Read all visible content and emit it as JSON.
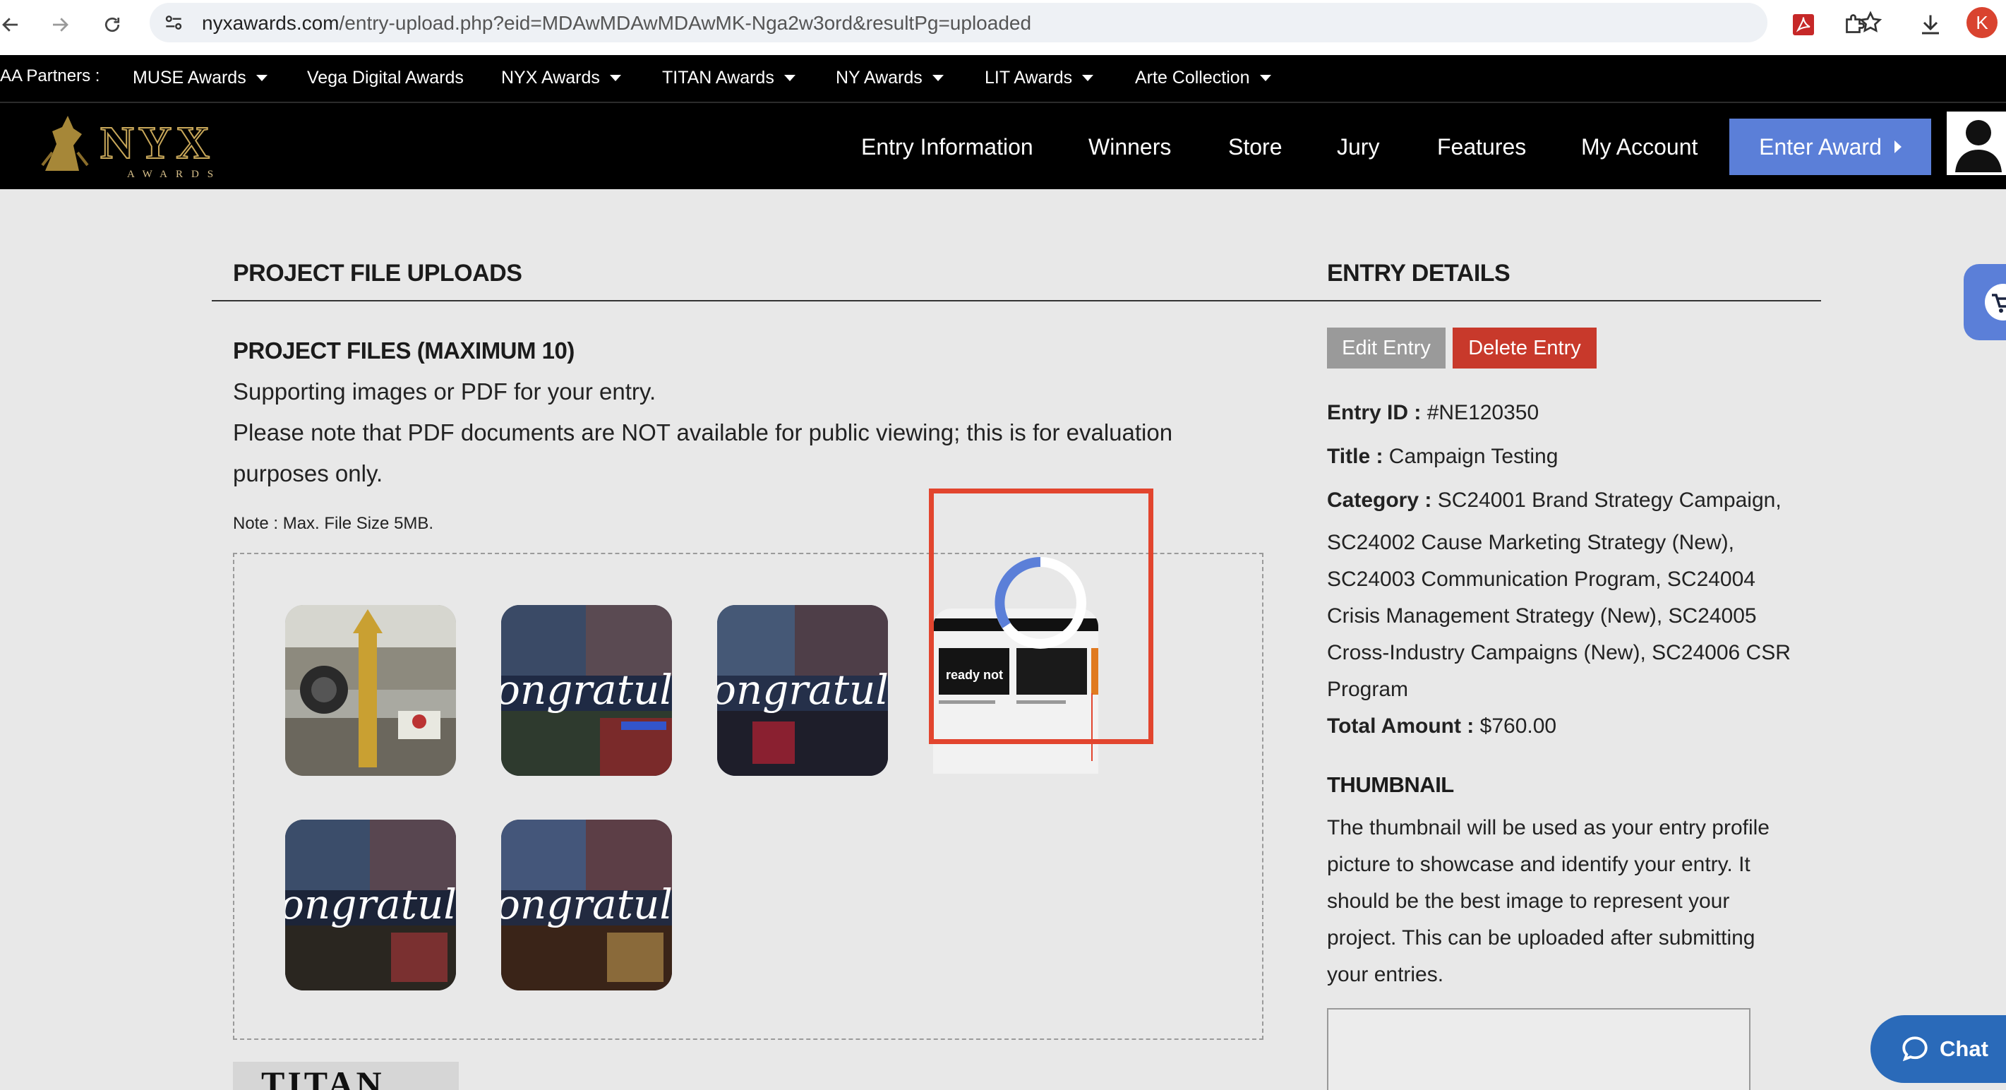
{
  "browser": {
    "url_host": "nyxawards.com",
    "url_path": "/entry-upload.php?eid=MDAwMDAwMDAwMK-Nga2w3ord&resultPg=uploaded",
    "profile_initial": "K"
  },
  "partners": {
    "label": "AA Partners :",
    "items": [
      "MUSE Awards",
      "Vega Digital Awards",
      "NYX Awards",
      "TITAN Awards",
      "NY Awards",
      "LIT Awards",
      "Arte Collection"
    ]
  },
  "header": {
    "logo_text": "NYX",
    "logo_sub": "AWARDS",
    "nav": [
      "Entry Information",
      "Winners",
      "Store",
      "Jury",
      "Features",
      "My Account"
    ],
    "enter_button": "Enter Award"
  },
  "uploads": {
    "section_title": "PROJECT FILE UPLOADS",
    "files_title": "PROJECT FILES (MAXIMUM 10)",
    "line1": "Supporting images or PDF for your entry.",
    "line2": "Please note that PDF documents are NOT available for public viewing; this is for evaluation",
    "line3": "purposes only.",
    "note": "Note : Max. File Size 5MB.",
    "thumb_overlay": "ongratulati",
    "thumb_small": "ready not",
    "bottom_logo": "TITAN"
  },
  "details": {
    "section_title": "ENTRY DETAILS",
    "edit_button": "Edit Entry",
    "delete_button": "Delete Entry",
    "entry_id_label": "Entry ID :",
    "entry_id": "#NE120350",
    "title_label": "Title :",
    "title": "Campaign Testing",
    "category_label": "Category :",
    "category_lines": [
      "SC24001 Brand Strategy Campaign,",
      "SC24002 Cause Marketing Strategy (New),",
      "SC24003 Communication Program, SC24004",
      "Crisis Management Strategy (New), SC24005",
      "Cross-Industry Campaigns (New), SC24006 CSR",
      "Program"
    ],
    "total_label": "Total Amount :",
    "total": "$760.00"
  },
  "thumbnail": {
    "title": "THUMBNAIL",
    "lines": [
      "The thumbnail will be used as your entry profile",
      "picture to showcase and identify your entry. It",
      "should be the best image to represent your",
      "project. This can be uploaded after submitting",
      "your entries."
    ]
  },
  "chat": {
    "label": "Chat"
  },
  "colors": {
    "accent": "#5b7fd8",
    "danger": "#c8392b",
    "highlight": "#e2452e"
  }
}
